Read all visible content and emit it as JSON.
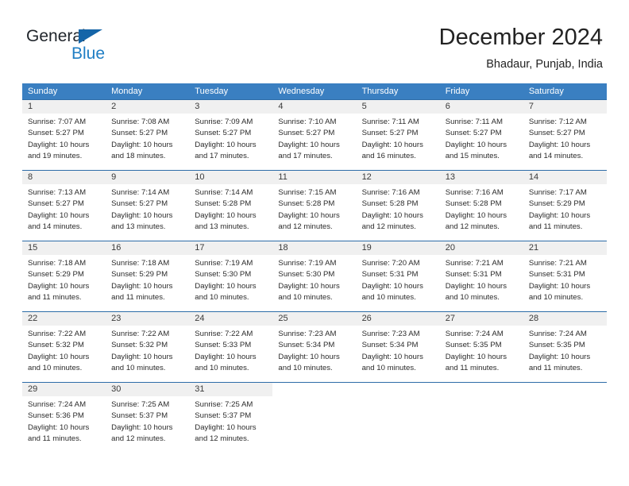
{
  "brand": {
    "name_part1": "General",
    "name_part2": "Blue",
    "accent_color": "#1f7ec4",
    "triangle_color": "#1565a8"
  },
  "header": {
    "title": "December 2024",
    "location": "Bhadaur, Punjab, India"
  },
  "theme": {
    "header_row_bg": "#3a7fc1",
    "week_separator": "#2d6ca8",
    "day_number_bg": "#f0f0f0"
  },
  "weekdays": [
    "Sunday",
    "Monday",
    "Tuesday",
    "Wednesday",
    "Thursday",
    "Friday",
    "Saturday"
  ],
  "weeks": [
    [
      {
        "day": "1",
        "sunrise": "Sunrise: 7:07 AM",
        "sunset": "Sunset: 5:27 PM",
        "daylight_line1": "Daylight: 10 hours",
        "daylight_line2": "and 19 minutes."
      },
      {
        "day": "2",
        "sunrise": "Sunrise: 7:08 AM",
        "sunset": "Sunset: 5:27 PM",
        "daylight_line1": "Daylight: 10 hours",
        "daylight_line2": "and 18 minutes."
      },
      {
        "day": "3",
        "sunrise": "Sunrise: 7:09 AM",
        "sunset": "Sunset: 5:27 PM",
        "daylight_line1": "Daylight: 10 hours",
        "daylight_line2": "and 17 minutes."
      },
      {
        "day": "4",
        "sunrise": "Sunrise: 7:10 AM",
        "sunset": "Sunset: 5:27 PM",
        "daylight_line1": "Daylight: 10 hours",
        "daylight_line2": "and 17 minutes."
      },
      {
        "day": "5",
        "sunrise": "Sunrise: 7:11 AM",
        "sunset": "Sunset: 5:27 PM",
        "daylight_line1": "Daylight: 10 hours",
        "daylight_line2": "and 16 minutes."
      },
      {
        "day": "6",
        "sunrise": "Sunrise: 7:11 AM",
        "sunset": "Sunset: 5:27 PM",
        "daylight_line1": "Daylight: 10 hours",
        "daylight_line2": "and 15 minutes."
      },
      {
        "day": "7",
        "sunrise": "Sunrise: 7:12 AM",
        "sunset": "Sunset: 5:27 PM",
        "daylight_line1": "Daylight: 10 hours",
        "daylight_line2": "and 14 minutes."
      }
    ],
    [
      {
        "day": "8",
        "sunrise": "Sunrise: 7:13 AM",
        "sunset": "Sunset: 5:27 PM",
        "daylight_line1": "Daylight: 10 hours",
        "daylight_line2": "and 14 minutes."
      },
      {
        "day": "9",
        "sunrise": "Sunrise: 7:14 AM",
        "sunset": "Sunset: 5:27 PM",
        "daylight_line1": "Daylight: 10 hours",
        "daylight_line2": "and 13 minutes."
      },
      {
        "day": "10",
        "sunrise": "Sunrise: 7:14 AM",
        "sunset": "Sunset: 5:28 PM",
        "daylight_line1": "Daylight: 10 hours",
        "daylight_line2": "and 13 minutes."
      },
      {
        "day": "11",
        "sunrise": "Sunrise: 7:15 AM",
        "sunset": "Sunset: 5:28 PM",
        "daylight_line1": "Daylight: 10 hours",
        "daylight_line2": "and 12 minutes."
      },
      {
        "day": "12",
        "sunrise": "Sunrise: 7:16 AM",
        "sunset": "Sunset: 5:28 PM",
        "daylight_line1": "Daylight: 10 hours",
        "daylight_line2": "and 12 minutes."
      },
      {
        "day": "13",
        "sunrise": "Sunrise: 7:16 AM",
        "sunset": "Sunset: 5:28 PM",
        "daylight_line1": "Daylight: 10 hours",
        "daylight_line2": "and 12 minutes."
      },
      {
        "day": "14",
        "sunrise": "Sunrise: 7:17 AM",
        "sunset": "Sunset: 5:29 PM",
        "daylight_line1": "Daylight: 10 hours",
        "daylight_line2": "and 11 minutes."
      }
    ],
    [
      {
        "day": "15",
        "sunrise": "Sunrise: 7:18 AM",
        "sunset": "Sunset: 5:29 PM",
        "daylight_line1": "Daylight: 10 hours",
        "daylight_line2": "and 11 minutes."
      },
      {
        "day": "16",
        "sunrise": "Sunrise: 7:18 AM",
        "sunset": "Sunset: 5:29 PM",
        "daylight_line1": "Daylight: 10 hours",
        "daylight_line2": "and 11 minutes."
      },
      {
        "day": "17",
        "sunrise": "Sunrise: 7:19 AM",
        "sunset": "Sunset: 5:30 PM",
        "daylight_line1": "Daylight: 10 hours",
        "daylight_line2": "and 10 minutes."
      },
      {
        "day": "18",
        "sunrise": "Sunrise: 7:19 AM",
        "sunset": "Sunset: 5:30 PM",
        "daylight_line1": "Daylight: 10 hours",
        "daylight_line2": "and 10 minutes."
      },
      {
        "day": "19",
        "sunrise": "Sunrise: 7:20 AM",
        "sunset": "Sunset: 5:31 PM",
        "daylight_line1": "Daylight: 10 hours",
        "daylight_line2": "and 10 minutes."
      },
      {
        "day": "20",
        "sunrise": "Sunrise: 7:21 AM",
        "sunset": "Sunset: 5:31 PM",
        "daylight_line1": "Daylight: 10 hours",
        "daylight_line2": "and 10 minutes."
      },
      {
        "day": "21",
        "sunrise": "Sunrise: 7:21 AM",
        "sunset": "Sunset: 5:31 PM",
        "daylight_line1": "Daylight: 10 hours",
        "daylight_line2": "and 10 minutes."
      }
    ],
    [
      {
        "day": "22",
        "sunrise": "Sunrise: 7:22 AM",
        "sunset": "Sunset: 5:32 PM",
        "daylight_line1": "Daylight: 10 hours",
        "daylight_line2": "and 10 minutes."
      },
      {
        "day": "23",
        "sunrise": "Sunrise: 7:22 AM",
        "sunset": "Sunset: 5:32 PM",
        "daylight_line1": "Daylight: 10 hours",
        "daylight_line2": "and 10 minutes."
      },
      {
        "day": "24",
        "sunrise": "Sunrise: 7:22 AM",
        "sunset": "Sunset: 5:33 PM",
        "daylight_line1": "Daylight: 10 hours",
        "daylight_line2": "and 10 minutes."
      },
      {
        "day": "25",
        "sunrise": "Sunrise: 7:23 AM",
        "sunset": "Sunset: 5:34 PM",
        "daylight_line1": "Daylight: 10 hours",
        "daylight_line2": "and 10 minutes."
      },
      {
        "day": "26",
        "sunrise": "Sunrise: 7:23 AM",
        "sunset": "Sunset: 5:34 PM",
        "daylight_line1": "Daylight: 10 hours",
        "daylight_line2": "and 10 minutes."
      },
      {
        "day": "27",
        "sunrise": "Sunrise: 7:24 AM",
        "sunset": "Sunset: 5:35 PM",
        "daylight_line1": "Daylight: 10 hours",
        "daylight_line2": "and 11 minutes."
      },
      {
        "day": "28",
        "sunrise": "Sunrise: 7:24 AM",
        "sunset": "Sunset: 5:35 PM",
        "daylight_line1": "Daylight: 10 hours",
        "daylight_line2": "and 11 minutes."
      }
    ],
    [
      {
        "day": "29",
        "sunrise": "Sunrise: 7:24 AM",
        "sunset": "Sunset: 5:36 PM",
        "daylight_line1": "Daylight: 10 hours",
        "daylight_line2": "and 11 minutes."
      },
      {
        "day": "30",
        "sunrise": "Sunrise: 7:25 AM",
        "sunset": "Sunset: 5:37 PM",
        "daylight_line1": "Daylight: 10 hours",
        "daylight_line2": "and 12 minutes."
      },
      {
        "day": "31",
        "sunrise": "Sunrise: 7:25 AM",
        "sunset": "Sunset: 5:37 PM",
        "daylight_line1": "Daylight: 10 hours",
        "daylight_line2": "and 12 minutes."
      },
      {
        "day": "",
        "sunrise": "",
        "sunset": "",
        "daylight_line1": "",
        "daylight_line2": ""
      },
      {
        "day": "",
        "sunrise": "",
        "sunset": "",
        "daylight_line1": "",
        "daylight_line2": ""
      },
      {
        "day": "",
        "sunrise": "",
        "sunset": "",
        "daylight_line1": "",
        "daylight_line2": ""
      },
      {
        "day": "",
        "sunrise": "",
        "sunset": "",
        "daylight_line1": "",
        "daylight_line2": ""
      }
    ]
  ]
}
